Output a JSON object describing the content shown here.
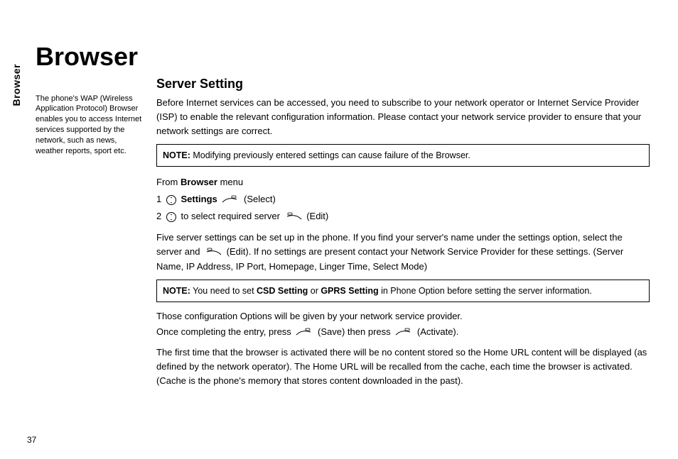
{
  "sideTab": "Browser",
  "chapterTitle": "Browser",
  "aside": "The phone's WAP (Wireless Application Protocol) Browser enables you to access Internet services supported by the network, such as news, weather reports, sport etc.",
  "section": {
    "title": "Server Setting",
    "intro": "Before Internet services can be accessed, you need to subscribe to your network operator or Internet Service Provider (ISP) to enable the relevant configuration information. Please contact your network service provider to ensure that your network settings are correct.",
    "note1": {
      "label": "NOTE:",
      "text": " Modifying previously entered settings can cause failure of the Browser."
    },
    "from_prefix": "From ",
    "from_bold": "Browser",
    "from_suffix": " menu",
    "step1_num": "1",
    "step1_bold": "Settings",
    "step1_action": "(Select)",
    "step2_num": "2",
    "step2_text": "to select required server",
    "step2_action": "(Edit)",
    "para2a": "Five server settings can be set up in the phone. If you find your server's name under the settings option, select the server and ",
    "para2b": " (Edit). If no settings are present contact your Network Service Provider for these settings. (Server Name, IP Address, IP Port, Homepage, Linger Time, Select Mode)",
    "note2": {
      "label": "NOTE:",
      "pre": " You need to set ",
      "b1": "CSD Setting",
      "mid": " or ",
      "b2": "GPRS Setting",
      "post": " in Phone Option before setting the server information."
    },
    "para3": "Those configuration Options will be given by your network service provider.",
    "para4a": "Once completing the entry, press ",
    "para4b": " (Save) then press ",
    "para4c": " (Activate).",
    "para5": "The first time that the browser is activated there will be no content stored so the Home URL content will be displayed (as defined by the network operator). The Home URL will be recalled from the cache, each time the browser is activated. (Cache is the phone's memory that stores content downloaded in the past)."
  },
  "pageNumber": "37"
}
